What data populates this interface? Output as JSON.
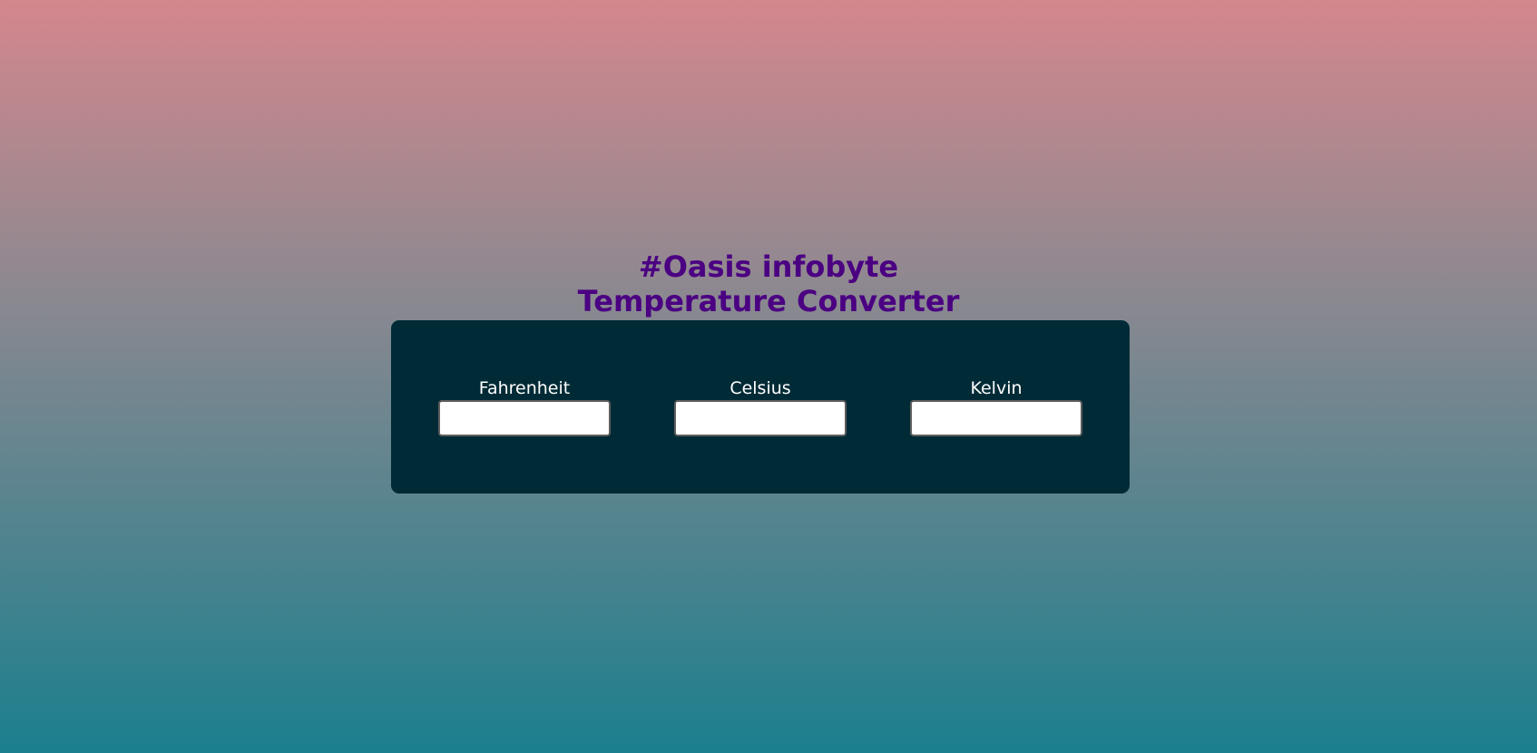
{
  "header": {
    "line1": "#Oasis infobyte",
    "line2": "Temperature Converter"
  },
  "converter": {
    "fields": [
      {
        "label": "Fahrenheit",
        "value": "",
        "placeholder": ""
      },
      {
        "label": "Celsius",
        "value": "",
        "placeholder": ""
      },
      {
        "label": "Kelvin",
        "value": "",
        "placeholder": ""
      }
    ]
  },
  "colors": {
    "heading": "#4b0082",
    "panel": "#002b36",
    "label": "#ffffff",
    "gradient_top": "#d4878d",
    "gradient_bottom": "#1b7f8d"
  }
}
